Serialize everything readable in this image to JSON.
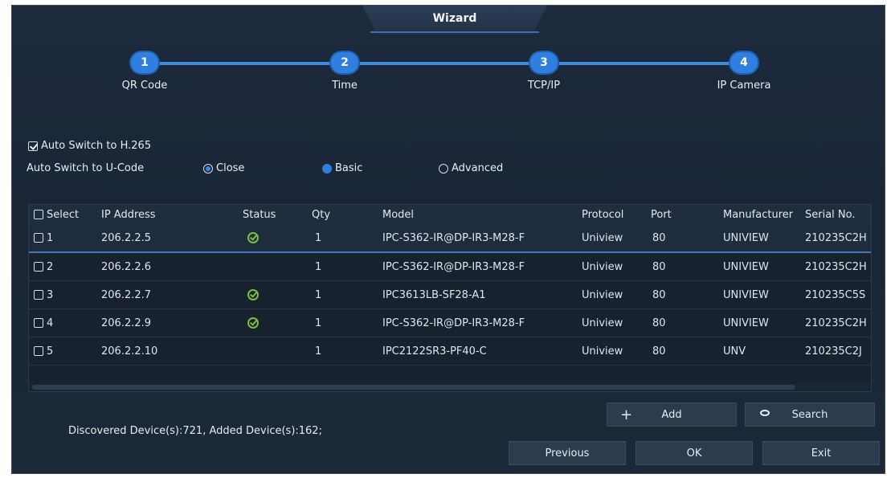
{
  "window": {
    "title": "Wizard"
  },
  "steps": [
    {
      "number": "1",
      "label": "QR Code"
    },
    {
      "number": "2",
      "label": "Time"
    },
    {
      "number": "3",
      "label": "TCP/IP"
    },
    {
      "number": "4",
      "label": "IP Camera"
    }
  ],
  "options": {
    "h265_label": "Auto Switch to H.265",
    "h265_checked": true,
    "ucode_label": "Auto Switch to U-Code",
    "ucode_choices": [
      "Close",
      "Basic",
      "Advanced"
    ],
    "ucode_selected": "Close"
  },
  "table": {
    "headers": [
      "Select",
      "IP Address",
      "Status",
      "Qty",
      "Model",
      "Protocol",
      "Port",
      "Manufacturer",
      "Serial No."
    ],
    "rows": [
      {
        "index": "1",
        "ip": "206.2.2.5",
        "status_ok": true,
        "qty": "1",
        "model": "IPC-S362-IR@DP-IR3-M28-F",
        "protocol": "Uniview",
        "port": "80",
        "manufacturer": "UNIVIEW",
        "serial": "210235C2H"
      },
      {
        "index": "2",
        "ip": "206.2.2.6",
        "status_ok": false,
        "qty": "1",
        "model": "IPC-S362-IR@DP-IR3-M28-F",
        "protocol": "Uniview",
        "port": "80",
        "manufacturer": "UNIVIEW",
        "serial": "210235C2H"
      },
      {
        "index": "3",
        "ip": "206.2.2.7",
        "status_ok": true,
        "qty": "1",
        "model": "IPC3613LB-SF28-A1",
        "protocol": "Uniview",
        "port": "80",
        "manufacturer": "UNIVIEW",
        "serial": "210235C5S"
      },
      {
        "index": "4",
        "ip": "206.2.2.9",
        "status_ok": true,
        "qty": "1",
        "model": "IPC-S362-IR@DP-IR3-M28-F",
        "protocol": "Uniview",
        "port": "80",
        "manufacturer": "UNIVIEW",
        "serial": "210235C2H"
      },
      {
        "index": "5",
        "ip": "206.2.2.10",
        "status_ok": false,
        "qty": "1",
        "model": "IPC2122SR3-PF40-C",
        "protocol": "Uniview",
        "port": "80",
        "manufacturer": "UNV",
        "serial": "210235C2J"
      }
    ]
  },
  "buttons": {
    "add": "Add",
    "search": "Search",
    "previous": "Previous",
    "ok": "OK",
    "exit": "Exit"
  },
  "status": {
    "summary": "Discovered Device(s):721, Added Device(s):162;"
  },
  "colors": {
    "accent": "#2f7fe0",
    "ok_green": "#76c043",
    "background": "#1b2837"
  }
}
